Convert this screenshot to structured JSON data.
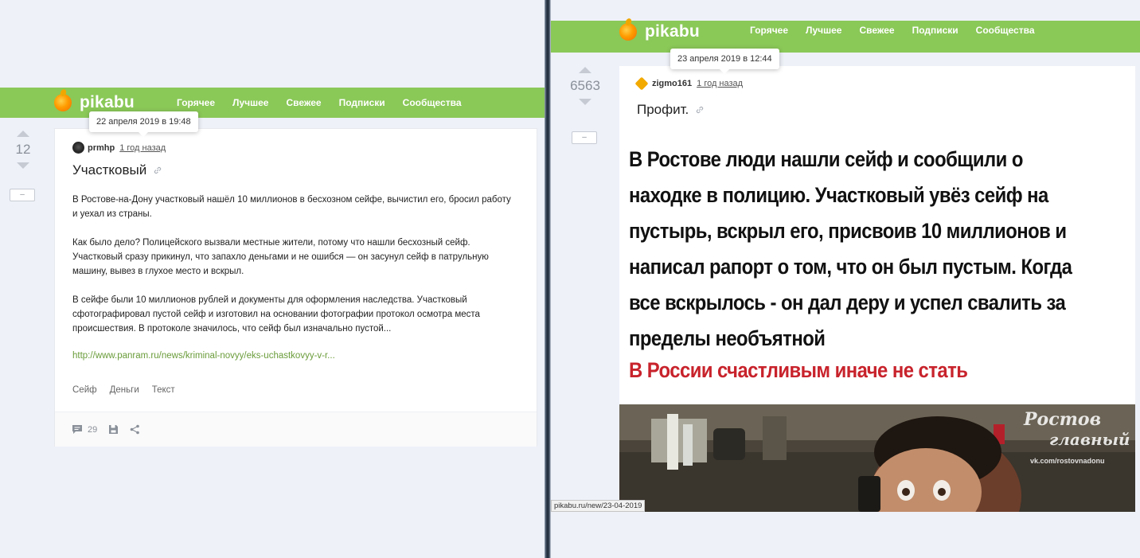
{
  "left": {
    "logo_text": "pikabu",
    "nav": [
      "Горячее",
      "Лучшее",
      "Свежее",
      "Подписки",
      "Сообщества"
    ],
    "tooltip": "22 апреля 2019 в 19:48",
    "rating": "12",
    "collapse": "–",
    "author": "prmhp",
    "date": "1 год назад",
    "title": "Участковый",
    "paragraphs": [
      "В Ростове-на-Дону участковый нашёл 10 миллионов в бесхозном сейфе, вычистил его, бросил работу и уехал из страны.",
      "Как было дело? Полицейского вызвали местные жители, потому что нашли бесхозный сейф. Участковый сразу прикинул, что запахло деньгами и не ошибся — он засунул сейф в патрульную машину, вывез в глухое место и вскрыл.",
      "В сейфе были 10 миллионов рублей и документы для оформления наследства. Участковый сфотографировал пустой сейф и изготовил на основании фотографии протокол осмотра места происшествия. В протоколе значилось, что сейф был изначально пустой..."
    ],
    "source_link": "http://www.panram.ru/news/kriminal-novyy/eks-uchastkovyy-v-r...",
    "tags": [
      "Сейф",
      "Деньги",
      "Текст"
    ],
    "comments_count": "29",
    "icons": {
      "comments": "comment-icon",
      "save": "save-icon",
      "share": "share-icon"
    }
  },
  "right": {
    "logo_text": "pikabu",
    "nav": [
      "Горячее",
      "Лучшее",
      "Свежее",
      "Подписки",
      "Сообщества"
    ],
    "tooltip": "23 апреля 2019 в 12:44",
    "rating": "6563",
    "collapse": "–",
    "author": "zigmo161",
    "date": "1 год назад",
    "title": "Профит.",
    "image_text_lines": [
      "В Ростове люди нашли сейф и сообщили о",
      "находке в полицию. Участковый увёз сейф на",
      "пустырь, вскрыл его, присвоив 10 миллионов и",
      "написал рапорт о том, что он был пустым. Когда",
      "все вскрылось - он дал деру и успел свалить за",
      "пределы необъятной"
    ],
    "image_subtitle": "В России счастливым иначе не стать",
    "watermark_line1": "Ростов",
    "watermark_line2": "главный",
    "watermark_small": "vk.com/rostovnadonu",
    "status_url": "pikabu.ru/new/23-04-2019"
  },
  "colors": {
    "brand_green": "#8ac858",
    "link_green": "#6a9c3a",
    "accent_red": "#c8232c"
  }
}
